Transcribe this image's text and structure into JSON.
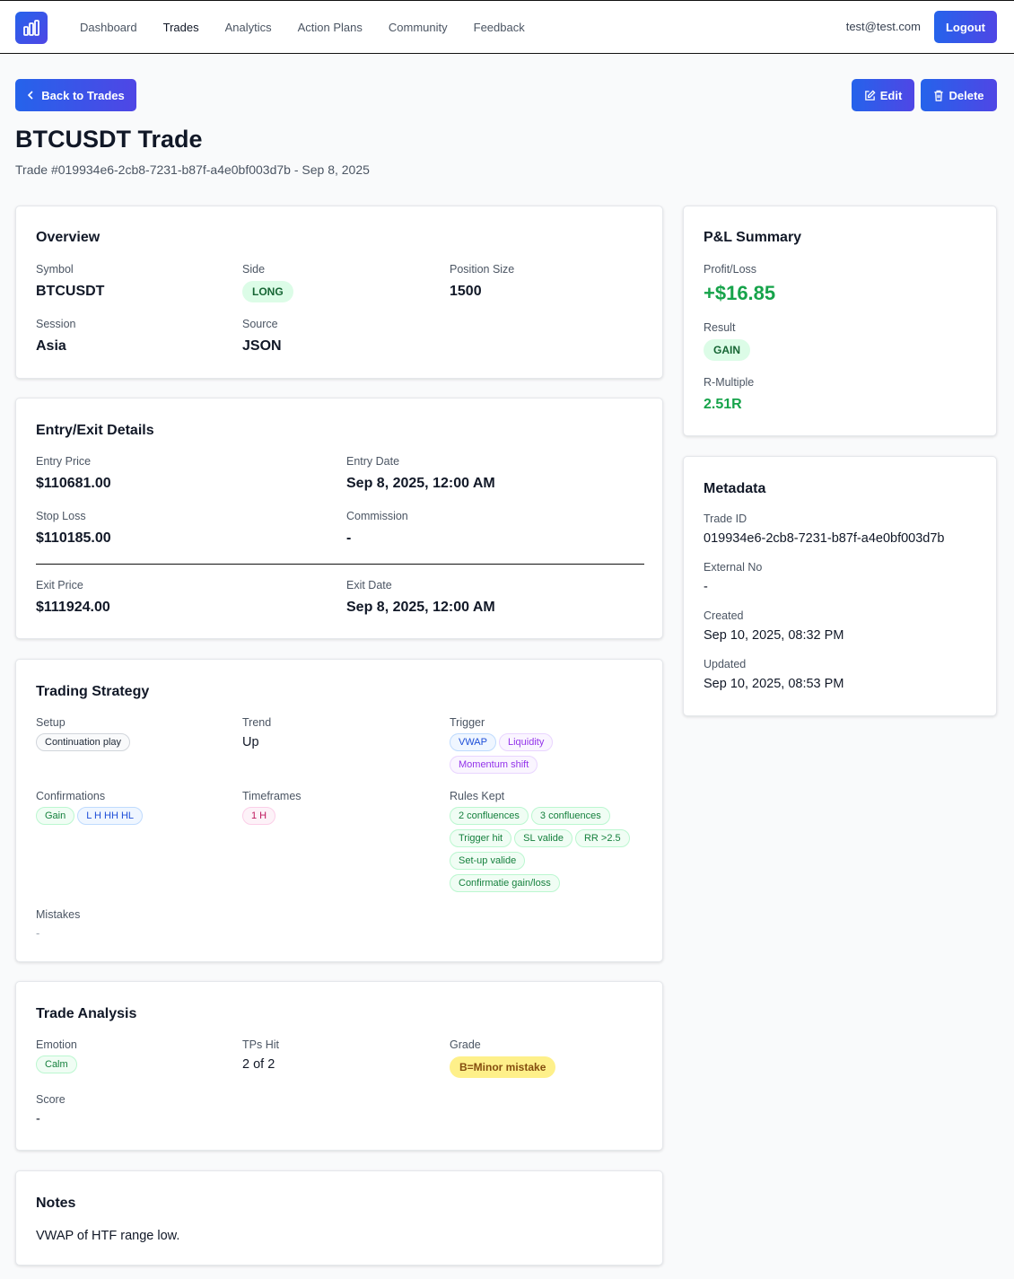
{
  "nav": {
    "links": [
      "Dashboard",
      "Trades",
      "Analytics",
      "Action Plans",
      "Community",
      "Feedback"
    ],
    "email": "test@test.com",
    "logout": "Logout"
  },
  "header": {
    "back": "Back to Trades",
    "edit": "Edit",
    "delete": "Delete",
    "title": "BTCUSDT Trade",
    "subtitle": "Trade #019934e6-2cb8-7231-b87f-a4e0bf003d7b - Sep 8, 2025"
  },
  "overview": {
    "title": "Overview",
    "symbol_label": "Symbol",
    "symbol": "BTCUSDT",
    "side_label": "Side",
    "side": "LONG",
    "size_label": "Position Size",
    "size": "1500",
    "session_label": "Session",
    "session": "Asia",
    "source_label": "Source",
    "source": "JSON"
  },
  "entry_exit": {
    "title": "Entry/Exit Details",
    "entry_price_label": "Entry Price",
    "entry_price": "$110681.00",
    "entry_date_label": "Entry Date",
    "entry_date": "Sep 8, 2025, 12:00 AM",
    "stop_loss_label": "Stop Loss",
    "stop_loss": "$110185.00",
    "commission_label": "Commission",
    "commission": "-",
    "exit_price_label": "Exit Price",
    "exit_price": "$111924.00",
    "exit_date_label": "Exit Date",
    "exit_date": "Sep 8, 2025, 12:00 AM"
  },
  "strategy": {
    "title": "Trading Strategy",
    "setup_label": "Setup",
    "setup": [
      "Continuation play"
    ],
    "trend_label": "Trend",
    "trend": "Up",
    "trigger_label": "Trigger",
    "trigger": [
      "VWAP",
      "Liquidity",
      "Momentum shift"
    ],
    "confirmations_label": "Confirmations",
    "confirmations": [
      "Gain",
      "L H HH HL"
    ],
    "timeframes_label": "Timeframes",
    "timeframes": [
      "1 H"
    ],
    "rules_label": "Rules Kept",
    "rules": [
      "2 confluences",
      "3 confluences",
      "Trigger hit",
      "SL valide",
      "RR >2.5",
      "Set-up valide",
      "Confirmatie gain/loss"
    ],
    "mistakes_label": "Mistakes",
    "mistakes": "-"
  },
  "analysis": {
    "title": "Trade Analysis",
    "emotion_label": "Emotion",
    "emotion": "Calm",
    "tps_label": "TPs Hit",
    "tps": "2 of 2",
    "grade_label": "Grade",
    "grade": "B=Minor mistake",
    "score_label": "Score",
    "score": "-"
  },
  "notes": {
    "title": "Notes",
    "text": "VWAP of HTF range low."
  },
  "pnl": {
    "title": "P&L Summary",
    "pl_label": "Profit/Loss",
    "pl": "+$16.85",
    "result_label": "Result",
    "result": "GAIN",
    "r_label": "R-Multiple",
    "r": "2.51R"
  },
  "metadata": {
    "title": "Metadata",
    "id_label": "Trade ID",
    "id": "019934e6-2cb8-7231-b87f-a4e0bf003d7b",
    "ext_label": "External No",
    "ext": "-",
    "created_label": "Created",
    "created": "Sep 10, 2025, 08:32 PM",
    "updated_label": "Updated",
    "updated": "Sep 10, 2025, 08:53 PM"
  },
  "colors": {
    "accent": "#2563eb",
    "positive": "#16a34a",
    "grade_bg": "#fef08a"
  }
}
